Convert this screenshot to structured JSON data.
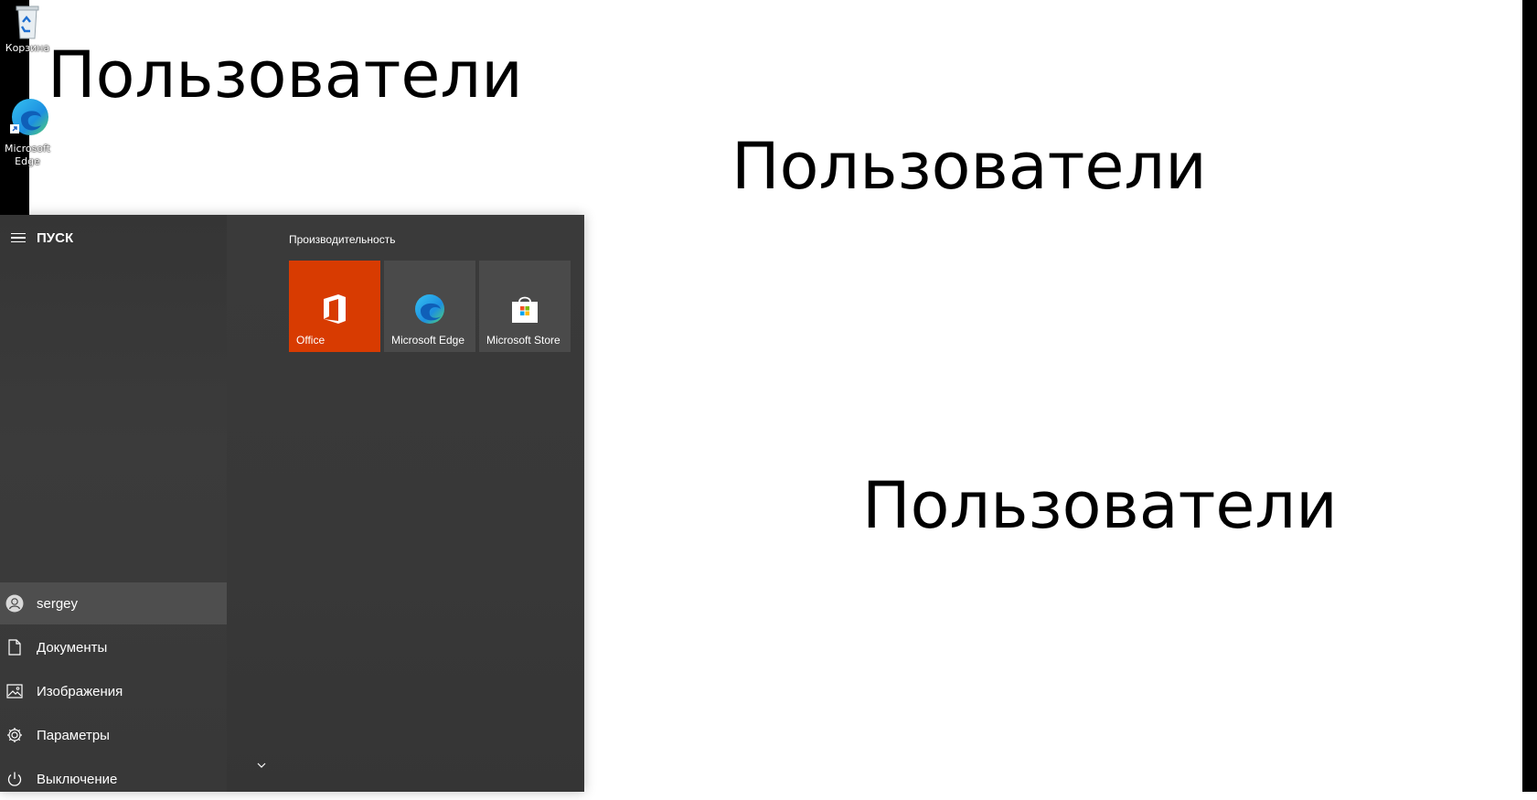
{
  "desktop": {
    "icons": [
      {
        "label": "Корзина",
        "icon": "recycle-bin-icon"
      },
      {
        "label_line1": "Microsoft",
        "label_line2": "Edge",
        "icon": "edge-icon"
      }
    ],
    "headings": [
      "Пользователи",
      "Пользователи",
      "Пользователи"
    ]
  },
  "start_menu": {
    "title": "ПУСК",
    "left_items": [
      {
        "label": "sergey",
        "icon": "user-avatar-icon"
      },
      {
        "label": "Документы",
        "icon": "document-icon"
      },
      {
        "label": "Изображения",
        "icon": "pictures-icon"
      },
      {
        "label": "Параметры",
        "icon": "gear-icon"
      },
      {
        "label": "Выключение",
        "icon": "power-icon"
      }
    ],
    "group_title": "Производительность",
    "tiles": [
      {
        "label": "Office",
        "icon": "office-icon",
        "color": "#d83b01"
      },
      {
        "label": "Microsoft Edge",
        "icon": "edge-icon",
        "color": "#4a4a4a"
      },
      {
        "label": "Microsoft Store",
        "icon": "store-icon",
        "color": "#4a4a4a"
      }
    ]
  },
  "colors": {
    "start_bg": "#2f2f2f",
    "office_tile": "#d83b01",
    "tile_bg": "#4a4a4a",
    "active_item": "#4e4e4e"
  }
}
